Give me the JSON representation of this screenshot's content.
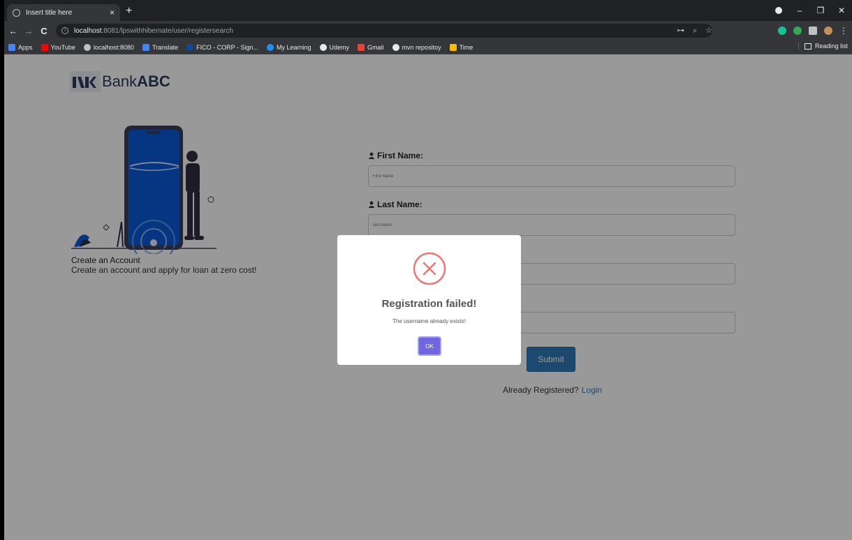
{
  "browser": {
    "tab_title": "Insert title here",
    "tab_close": "×",
    "new_tab": "+",
    "url_host": "localhost",
    "url_rest": ":8081/lpswithhibernate/user/registersearch",
    "back": "←",
    "forward": "→",
    "reload": "C",
    "window_min": "–",
    "window_restore": "❐",
    "window_close": "✕",
    "bookmarks": [
      {
        "label": "Apps",
        "color": "#f4b400"
      },
      {
        "label": "YouTube",
        "color": "#ff0000"
      },
      {
        "label": "localhost:8080",
        "color": "#bdc1c6"
      },
      {
        "label": "Translate",
        "color": "#4285f4"
      },
      {
        "label": "FICO - CORP - Sign...",
        "color": "#0b4aa2"
      },
      {
        "label": "My Learning",
        "color": "#1e90ff"
      },
      {
        "label": "Udemy",
        "color": "#e8eaed"
      },
      {
        "label": "Gmail",
        "color": "#ea4335"
      },
      {
        "label": "mvn repositoy",
        "color": "#e8eaed"
      },
      {
        "label": "Time",
        "color": "#fbbc05"
      }
    ],
    "reading_list": "Reading list"
  },
  "page": {
    "logo_text": "Bank",
    "logo_bold": "ABC",
    "create_title": "Create an Account",
    "create_subtitle": "Create an account and apply for loan at zero cost!",
    "form": {
      "first_name_label": "First Name:",
      "first_name_placeholder": "First Name",
      "last_name_label": "Last Name:",
      "last_name_placeholder": "last Name"
    },
    "submit_label": "Submit",
    "already_registered": "Already Registered?",
    "login_link": "Login"
  },
  "modal": {
    "title": "Registration failed!",
    "message": "The username already exists!",
    "ok_label": "OK",
    "error_color": "#f27474",
    "button_color": "#7066e0"
  }
}
